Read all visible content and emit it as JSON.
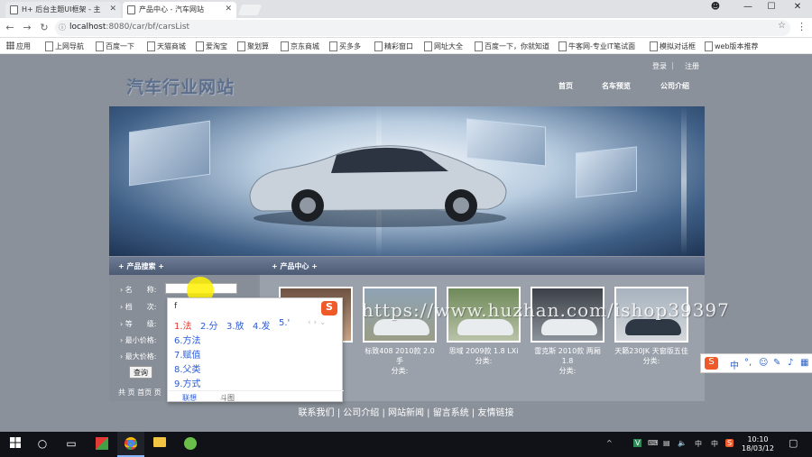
{
  "browser": {
    "tabs": [
      {
        "title": "H+ 后台主题UI框架 - 主",
        "active": false
      },
      {
        "title": "产品中心 - 汽车网站",
        "active": true
      }
    ],
    "window_controls": {
      "account": "☻",
      "minimize": "—",
      "maximize": "☐",
      "close": "✕"
    },
    "url_host": "localhost",
    "url_path": ":8080/car/bf/carsList",
    "bookmarks": [
      "应用",
      "上网导航",
      "百度一下",
      "天猫商城",
      "爱淘宝",
      "聚划算",
      "京东商城",
      "买多多",
      "精彩窗口",
      "网址大全",
      "百度一下，你就知道",
      "牛客网-专业IT笔试面",
      "模拟对话框",
      "web版本推荐"
    ]
  },
  "site": {
    "logo": "汽车行业网站",
    "top_links": {
      "login": "登录",
      "register": "注册"
    },
    "nav": [
      "首页",
      "名车预览",
      "公司介绍"
    ],
    "section_search": "产品搜索",
    "section_products": "产品中心",
    "form": {
      "name_label": "名　　称:",
      "grade_label": "档　　次:",
      "level_label": "等　　级:",
      "min_price_label": "最小价格:",
      "max_price_label": "最大价格:",
      "search_button": "查询",
      "pager": "共 页 首页 页"
    },
    "products": [
      {
        "name": ""
      },
      {
        "name": "标致408 2010款 2.0 手\n分类:"
      },
      {
        "name": "思域 2009款 1.8 LXi\n分类:"
      },
      {
        "name": "雷克斯 2010款 两厢 1.8\n分类:"
      },
      {
        "name": "天籁230JK 天窗版五佳\n分类:"
      }
    ],
    "footer": "联系我们 | 公司介绍 | 网站新闻 | 留言系统 | 友情链接"
  },
  "watermark": "https://www.huzhan.com/ishop39397",
  "ime": {
    "input": "f",
    "logo": "S",
    "candidates": [
      "1.法",
      "2.分",
      "3.放",
      "4.发",
      "5.'",
      "6.方法",
      "7.赋值",
      "8.父类",
      "9.方式"
    ],
    "nav": "‹ › ⌄",
    "tabs": [
      "联想",
      "斗图"
    ],
    "toolbar": [
      "S",
      "中",
      "°,",
      "☺",
      "✎",
      "♪",
      "▦"
    ]
  },
  "taskbar": {
    "time": "10:10",
    "date": "18/03/12",
    "tray": [
      "^",
      "V",
      "中",
      "S"
    ]
  },
  "colors": {
    "page_bg": "#8b919a",
    "logo": "#5d6f8c",
    "section_bar": "#55637d"
  }
}
